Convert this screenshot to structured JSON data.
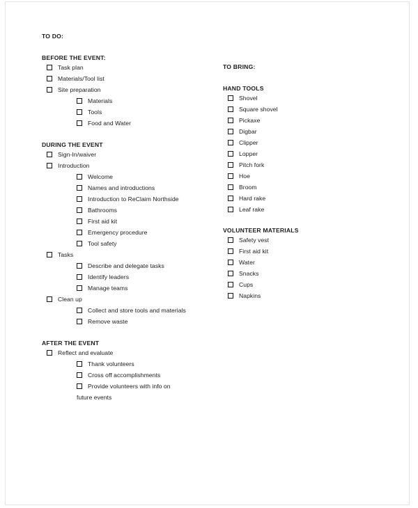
{
  "document": {
    "title": "TO DO:",
    "right_title": "TO BRING:"
  },
  "left_column": {
    "sections": [
      {
        "heading": "BEFORE THE EVENT:",
        "items": [
          {
            "label": "Task plan",
            "level": 1
          },
          {
            "label": "Materials/Tool list",
            "level": 1
          },
          {
            "label": "Site preparation",
            "level": 1
          },
          {
            "label": "Materials",
            "level": 2
          },
          {
            "label": "Tools",
            "level": 2
          },
          {
            "label": "Food and Water",
            "level": 2
          }
        ]
      },
      {
        "heading": "DURING THE EVENT",
        "items": [
          {
            "label": "Sign-In/waiver",
            "level": 1
          },
          {
            "label": "Introduction",
            "level": 1
          },
          {
            "label": "Welcome",
            "level": 2
          },
          {
            "label": "Names and introductions",
            "level": 2
          },
          {
            "label": "Introduction to ReClaim Northside",
            "level": 2
          },
          {
            "label": "Bathrooms",
            "level": 2
          },
          {
            "label": "First aid kit",
            "level": 2
          },
          {
            "label": "Emergency procedure",
            "level": 2
          },
          {
            "label": "Tool safety",
            "level": 2
          },
          {
            "label": "Tasks",
            "level": 1
          },
          {
            "label": "Describe and delegate tasks",
            "level": 2
          },
          {
            "label": "Identify leaders",
            "level": 2
          },
          {
            "label": "Manage teams",
            "level": 2
          },
          {
            "label": "Clean up",
            "level": 1
          },
          {
            "label": "Collect and store tools and materials",
            "level": 2
          },
          {
            "label": "Remove waste",
            "level": 2
          }
        ]
      },
      {
        "heading": "AFTER THE EVENT",
        "items": [
          {
            "label": "Reflect and evaluate",
            "level": 1
          },
          {
            "label": "Thank volunteers",
            "level": 2
          },
          {
            "label": "Cross off accomplishments",
            "level": 2
          },
          {
            "label": "Provide volunteers with info on future events",
            "level": 2,
            "wrap_line1": "Provide volunteers with info on",
            "wrap_line2": "future events"
          }
        ]
      }
    ]
  },
  "right_column": {
    "sections": [
      {
        "heading": "HAND TOOLS",
        "items": [
          {
            "label": "Shovel"
          },
          {
            "label": "Square shovel"
          },
          {
            "label": "Pickaxe"
          },
          {
            "label": "Digbar"
          },
          {
            "label": "Clipper"
          },
          {
            "label": "Lopper"
          },
          {
            "label": "Pitch fork"
          },
          {
            "label": "Hoe"
          },
          {
            "label": "Broom"
          },
          {
            "label": "Hard rake"
          },
          {
            "label": "Leaf rake"
          }
        ]
      },
      {
        "heading": "VOLUNTEER MATERIALS",
        "items": [
          {
            "label": "Safety vest"
          },
          {
            "label": "First aid kit"
          },
          {
            "label": "Water"
          },
          {
            "label": "Snacks"
          },
          {
            "label": "Cups"
          },
          {
            "label": "Napkins"
          }
        ]
      }
    ]
  },
  "colors": {
    "text": "#1b1b1b",
    "checkbox_border": "#141414",
    "page_border": "#e3e3e3",
    "page_background": "#ffffff"
  }
}
